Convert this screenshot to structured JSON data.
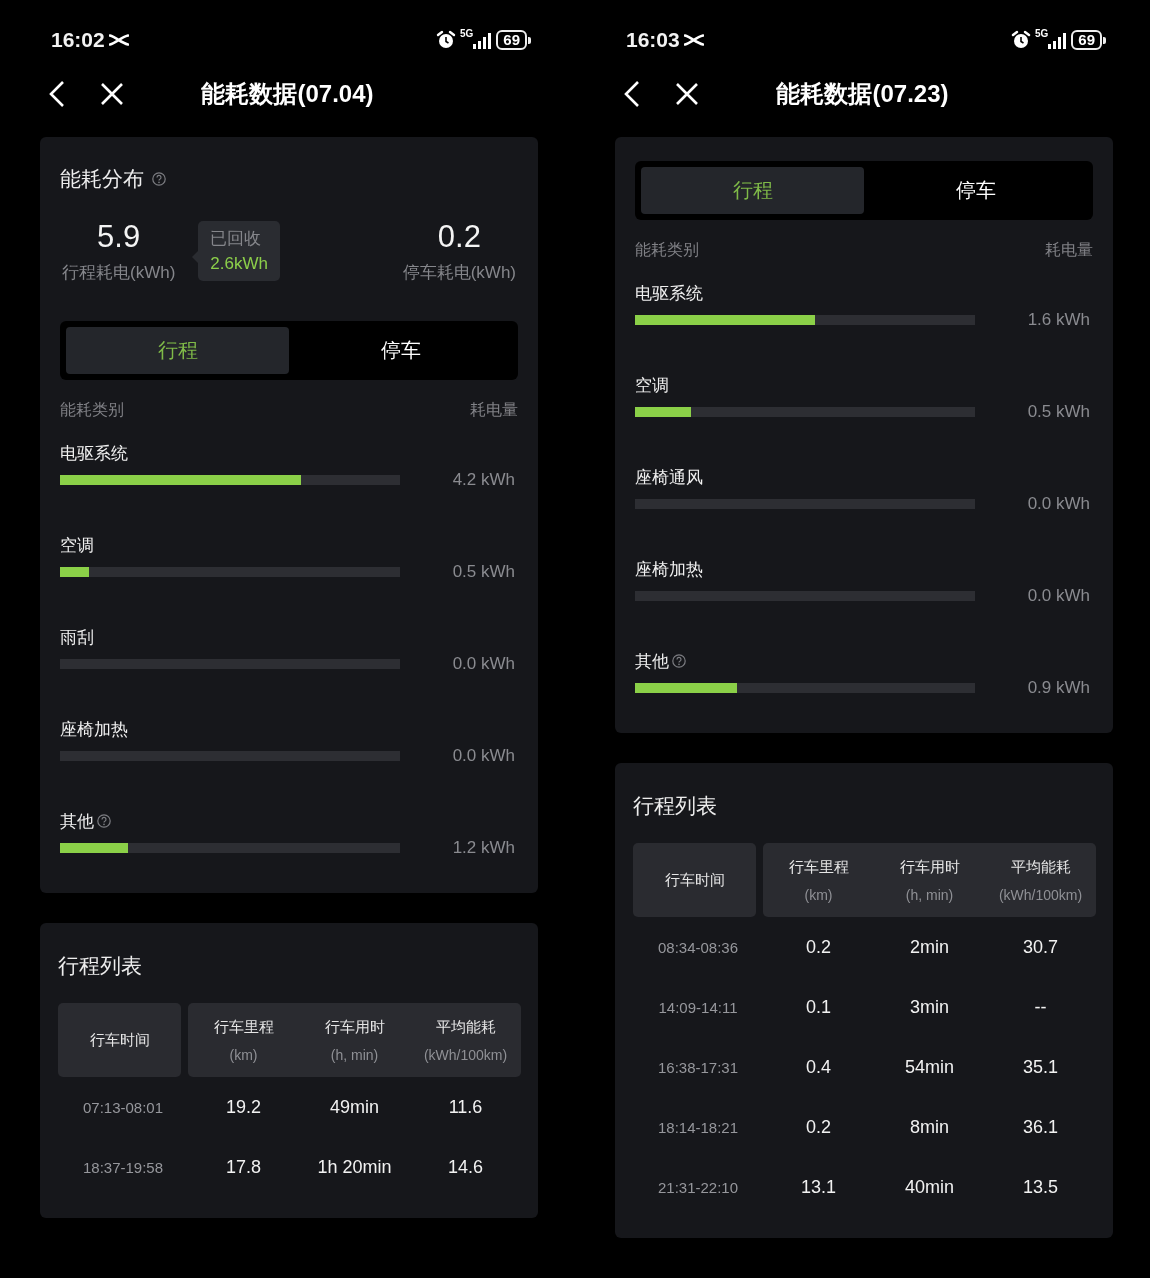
{
  "screens": [
    {
      "status_bar": {
        "time": "16:02",
        "network": "5G",
        "battery": "69"
      },
      "title": "能耗数据(07.04)",
      "distribution": {
        "title": "能耗分布",
        "help": true,
        "summary": {
          "trip_value": "5.9",
          "trip_label": "行程耗电(kWh)",
          "recovered_label": "已回收",
          "recovered_value": "2.6kWh",
          "parking_value": "0.2",
          "parking_label": "停车耗电(kWh)"
        },
        "tabs": [
          {
            "label": "行程",
            "selected": true
          },
          {
            "label": "停车",
            "selected": false
          }
        ],
        "column_left": "能耗类别",
        "column_right": "耗电量",
        "categories": [
          {
            "name": "电驱系统",
            "help": false,
            "level": 0.71,
            "reading": "4.2 kWh"
          },
          {
            "name": "空调",
            "help": false,
            "level": 0.085,
            "reading": "0.5 kWh"
          },
          {
            "name": "雨刮",
            "help": false,
            "level": 0,
            "reading": "0.0 kWh"
          },
          {
            "name": "座椅加热",
            "help": false,
            "level": 0,
            "reading": "0.0 kWh"
          },
          {
            "name": "其他",
            "help": true,
            "level": 0.2,
            "reading": "1.2 kWh"
          }
        ]
      },
      "trips": {
        "title": "行程列表",
        "columns": [
          {
            "label": "行车时间"
          },
          {
            "label": "行车里程",
            "unit": "(km)"
          },
          {
            "label": "行车用时",
            "unit": "(h, min)"
          },
          {
            "label": "平均能耗",
            "unit": "(kWh/100km)"
          }
        ],
        "rows": [
          [
            "07:13-08:01",
            "19.2",
            "49min",
            "11.6"
          ],
          [
            "18:37-19:58",
            "17.8",
            "1h 20min",
            "14.6"
          ]
        ]
      }
    },
    {
      "status_bar": {
        "time": "16:03",
        "network": "5G",
        "battery": "69"
      },
      "title": "能耗数据(07.23)",
      "distribution": {
        "tabs": [
          {
            "label": "行程",
            "selected": true
          },
          {
            "label": "停车",
            "selected": false
          }
        ],
        "column_left": "能耗类别",
        "column_right": "耗电量",
        "categories": [
          {
            "name": "电驱系统",
            "help": false,
            "level": 0.53,
            "reading": "1.6 kWh"
          },
          {
            "name": "空调",
            "help": false,
            "level": 0.165,
            "reading": "0.5 kWh"
          },
          {
            "name": "座椅通风",
            "help": false,
            "level": 0,
            "reading": "0.0 kWh"
          },
          {
            "name": "座椅加热",
            "help": false,
            "level": 0,
            "reading": "0.0 kWh"
          },
          {
            "name": "其他",
            "help": true,
            "level": 0.3,
            "reading": "0.9 kWh"
          }
        ]
      },
      "trips": {
        "title": "行程列表",
        "columns": [
          {
            "label": "行车时间"
          },
          {
            "label": "行车里程",
            "unit": "(km)"
          },
          {
            "label": "行车用时",
            "unit": "(h, min)"
          },
          {
            "label": "平均能耗",
            "unit": "(kWh/100km)"
          }
        ],
        "rows": [
          [
            "08:34-08:36",
            "0.2",
            "2min",
            "30.7"
          ],
          [
            "14:09-14:11",
            "0.1",
            "3min",
            "--"
          ],
          [
            "16:38-17:31",
            "0.4",
            "54min",
            "35.1"
          ],
          [
            "18:14-18:21",
            "0.2",
            "8min",
            "36.1"
          ],
          [
            "21:31-22:10",
            "13.1",
            "40min",
            "13.5"
          ]
        ]
      }
    }
  ]
}
